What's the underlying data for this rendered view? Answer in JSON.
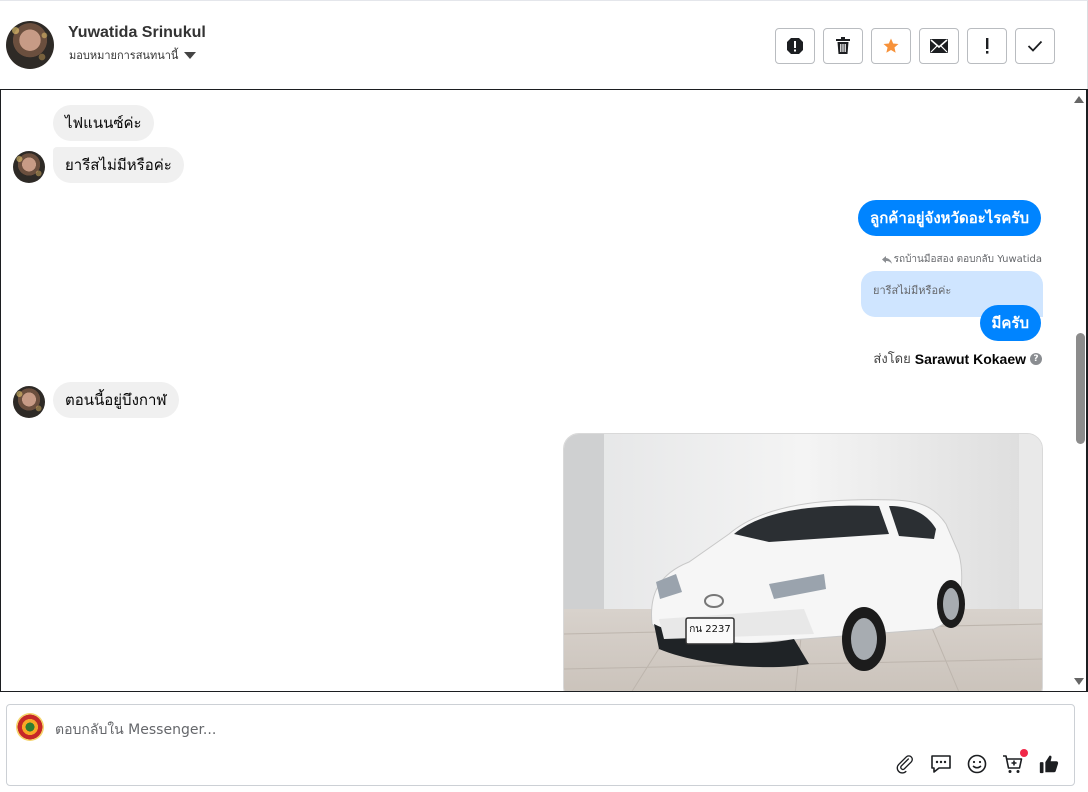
{
  "header": {
    "contact_name": "Yuwatida Srinukul",
    "assign_label": "มอบหมายการสนทนานี้",
    "tools": [
      {
        "name": "report-spam-icon"
      },
      {
        "name": "trash-icon"
      },
      {
        "name": "star-icon",
        "color": "#f7923a"
      },
      {
        "name": "envelope-icon"
      },
      {
        "name": "exclamation-icon"
      },
      {
        "name": "check-icon"
      }
    ]
  },
  "messages": {
    "in_1": "ไฟแนนซ์ค่ะ",
    "in_2": "ยารีสไม่มีหรือค่ะ",
    "out_1": "ลูกค้าอยู่จังหวัดอะไรครับ",
    "reply_meta": "รถบ้านมือสอง ตอบกลับ Yuwatida",
    "reply_quote": "ยารีสไม่มีหรือค่ะ",
    "out_2": "มีครับ",
    "sent_by_prefix": "ส่งโดย",
    "sent_by_name": "Sarawut Kokaew",
    "in_3": "ตอนนี้อยู่บึงกาฬ",
    "car_plate": "กน 2237"
  },
  "composer": {
    "placeholder": "ตอบกลับใน Messenger...",
    "icons": [
      "paperclip-icon",
      "saved-reply-icon",
      "emoji-icon",
      "shop-cart-icon",
      "thumbs-up-icon"
    ]
  },
  "colors": {
    "brand_blue": "#0084ff",
    "incoming_bubble": "#f0f0f0",
    "quote_bubble": "#cfe5ff",
    "notification_dot": "#f02849"
  }
}
